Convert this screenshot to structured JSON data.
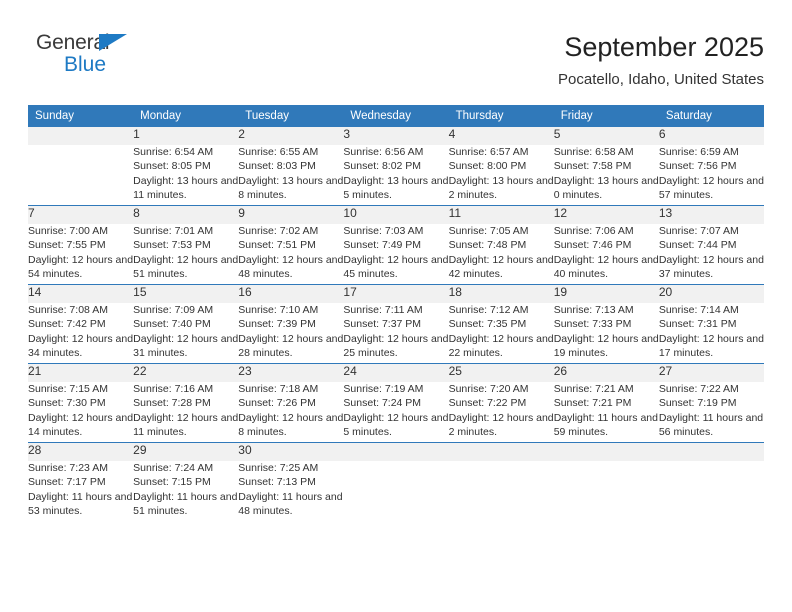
{
  "brand": {
    "name_top": "General",
    "name_bottom": "Blue",
    "accent_color": "#1e7ac4"
  },
  "header": {
    "title": "September 2025",
    "subtitle": "Pocatello, Idaho, United States"
  },
  "theme": {
    "header_blue": "#3079ba",
    "daynum_band": "#f1f1f1",
    "text": "#333333"
  },
  "calendar": {
    "weekday_headers": [
      "Sunday",
      "Monday",
      "Tuesday",
      "Wednesday",
      "Thursday",
      "Friday",
      "Saturday"
    ],
    "weeks": [
      [
        {
          "day": "",
          "sunrise": "",
          "sunset": "",
          "daylight": ""
        },
        {
          "day": "1",
          "sunrise": "Sunrise: 6:54 AM",
          "sunset": "Sunset: 8:05 PM",
          "daylight": "Daylight: 13 hours and 11 minutes."
        },
        {
          "day": "2",
          "sunrise": "Sunrise: 6:55 AM",
          "sunset": "Sunset: 8:03 PM",
          "daylight": "Daylight: 13 hours and 8 minutes."
        },
        {
          "day": "3",
          "sunrise": "Sunrise: 6:56 AM",
          "sunset": "Sunset: 8:02 PM",
          "daylight": "Daylight: 13 hours and 5 minutes."
        },
        {
          "day": "4",
          "sunrise": "Sunrise: 6:57 AM",
          "sunset": "Sunset: 8:00 PM",
          "daylight": "Daylight: 13 hours and 2 minutes."
        },
        {
          "day": "5",
          "sunrise": "Sunrise: 6:58 AM",
          "sunset": "Sunset: 7:58 PM",
          "daylight": "Daylight: 13 hours and 0 minutes."
        },
        {
          "day": "6",
          "sunrise": "Sunrise: 6:59 AM",
          "sunset": "Sunset: 7:56 PM",
          "daylight": "Daylight: 12 hours and 57 minutes."
        }
      ],
      [
        {
          "day": "7",
          "sunrise": "Sunrise: 7:00 AM",
          "sunset": "Sunset: 7:55 PM",
          "daylight": "Daylight: 12 hours and 54 minutes."
        },
        {
          "day": "8",
          "sunrise": "Sunrise: 7:01 AM",
          "sunset": "Sunset: 7:53 PM",
          "daylight": "Daylight: 12 hours and 51 minutes."
        },
        {
          "day": "9",
          "sunrise": "Sunrise: 7:02 AM",
          "sunset": "Sunset: 7:51 PM",
          "daylight": "Daylight: 12 hours and 48 minutes."
        },
        {
          "day": "10",
          "sunrise": "Sunrise: 7:03 AM",
          "sunset": "Sunset: 7:49 PM",
          "daylight": "Daylight: 12 hours and 45 minutes."
        },
        {
          "day": "11",
          "sunrise": "Sunrise: 7:05 AM",
          "sunset": "Sunset: 7:48 PM",
          "daylight": "Daylight: 12 hours and 42 minutes."
        },
        {
          "day": "12",
          "sunrise": "Sunrise: 7:06 AM",
          "sunset": "Sunset: 7:46 PM",
          "daylight": "Daylight: 12 hours and 40 minutes."
        },
        {
          "day": "13",
          "sunrise": "Sunrise: 7:07 AM",
          "sunset": "Sunset: 7:44 PM",
          "daylight": "Daylight: 12 hours and 37 minutes."
        }
      ],
      [
        {
          "day": "14",
          "sunrise": "Sunrise: 7:08 AM",
          "sunset": "Sunset: 7:42 PM",
          "daylight": "Daylight: 12 hours and 34 minutes."
        },
        {
          "day": "15",
          "sunrise": "Sunrise: 7:09 AM",
          "sunset": "Sunset: 7:40 PM",
          "daylight": "Daylight: 12 hours and 31 minutes."
        },
        {
          "day": "16",
          "sunrise": "Sunrise: 7:10 AM",
          "sunset": "Sunset: 7:39 PM",
          "daylight": "Daylight: 12 hours and 28 minutes."
        },
        {
          "day": "17",
          "sunrise": "Sunrise: 7:11 AM",
          "sunset": "Sunset: 7:37 PM",
          "daylight": "Daylight: 12 hours and 25 minutes."
        },
        {
          "day": "18",
          "sunrise": "Sunrise: 7:12 AM",
          "sunset": "Sunset: 7:35 PM",
          "daylight": "Daylight: 12 hours and 22 minutes."
        },
        {
          "day": "19",
          "sunrise": "Sunrise: 7:13 AM",
          "sunset": "Sunset: 7:33 PM",
          "daylight": "Daylight: 12 hours and 19 minutes."
        },
        {
          "day": "20",
          "sunrise": "Sunrise: 7:14 AM",
          "sunset": "Sunset: 7:31 PM",
          "daylight": "Daylight: 12 hours and 17 minutes."
        }
      ],
      [
        {
          "day": "21",
          "sunrise": "Sunrise: 7:15 AM",
          "sunset": "Sunset: 7:30 PM",
          "daylight": "Daylight: 12 hours and 14 minutes."
        },
        {
          "day": "22",
          "sunrise": "Sunrise: 7:16 AM",
          "sunset": "Sunset: 7:28 PM",
          "daylight": "Daylight: 12 hours and 11 minutes."
        },
        {
          "day": "23",
          "sunrise": "Sunrise: 7:18 AM",
          "sunset": "Sunset: 7:26 PM",
          "daylight": "Daylight: 12 hours and 8 minutes."
        },
        {
          "day": "24",
          "sunrise": "Sunrise: 7:19 AM",
          "sunset": "Sunset: 7:24 PM",
          "daylight": "Daylight: 12 hours and 5 minutes."
        },
        {
          "day": "25",
          "sunrise": "Sunrise: 7:20 AM",
          "sunset": "Sunset: 7:22 PM",
          "daylight": "Daylight: 12 hours and 2 minutes."
        },
        {
          "day": "26",
          "sunrise": "Sunrise: 7:21 AM",
          "sunset": "Sunset: 7:21 PM",
          "daylight": "Daylight: 11 hours and 59 minutes."
        },
        {
          "day": "27",
          "sunrise": "Sunrise: 7:22 AM",
          "sunset": "Sunset: 7:19 PM",
          "daylight": "Daylight: 11 hours and 56 minutes."
        }
      ],
      [
        {
          "day": "28",
          "sunrise": "Sunrise: 7:23 AM",
          "sunset": "Sunset: 7:17 PM",
          "daylight": "Daylight: 11 hours and 53 minutes."
        },
        {
          "day": "29",
          "sunrise": "Sunrise: 7:24 AM",
          "sunset": "Sunset: 7:15 PM",
          "daylight": "Daylight: 11 hours and 51 minutes."
        },
        {
          "day": "30",
          "sunrise": "Sunrise: 7:25 AM",
          "sunset": "Sunset: 7:13 PM",
          "daylight": "Daylight: 11 hours and 48 minutes."
        },
        {
          "day": "",
          "sunrise": "",
          "sunset": "",
          "daylight": ""
        },
        {
          "day": "",
          "sunrise": "",
          "sunset": "",
          "daylight": ""
        },
        {
          "day": "",
          "sunrise": "",
          "sunset": "",
          "daylight": ""
        },
        {
          "day": "",
          "sunrise": "",
          "sunset": "",
          "daylight": ""
        }
      ]
    ]
  }
}
